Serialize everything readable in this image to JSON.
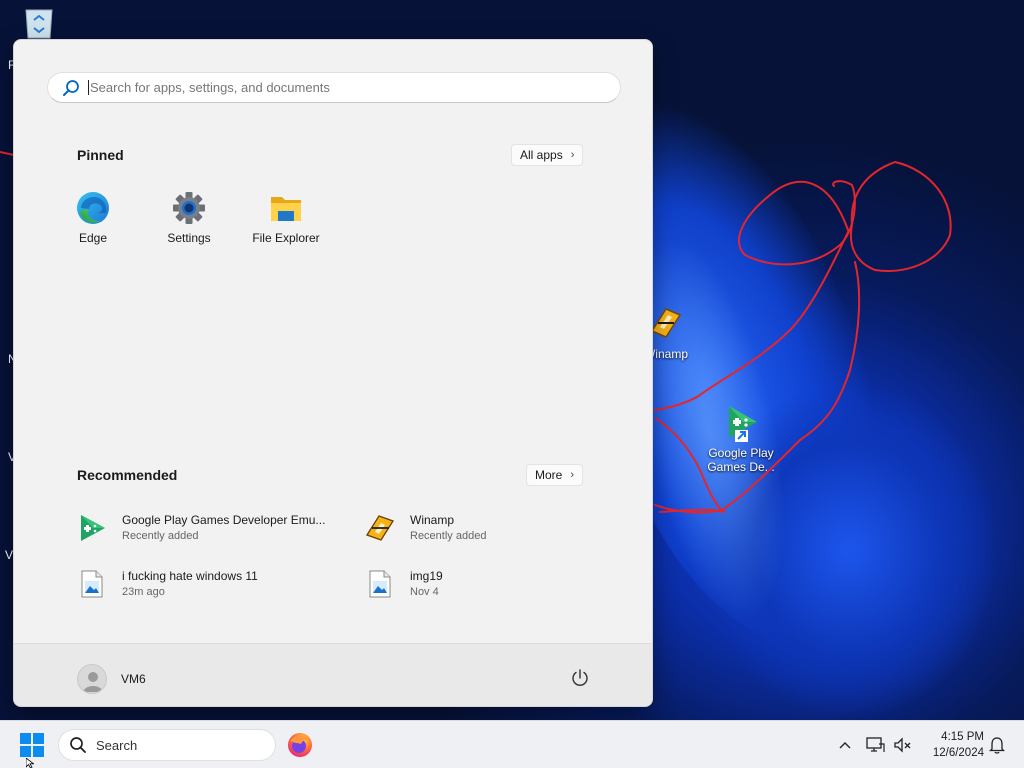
{
  "desktop": {
    "icons": [
      {
        "label": "Winamp",
        "icon": "winamp-icon"
      },
      {
        "label": "Google Play Games De...",
        "icon": "google-play-games-icon"
      }
    ],
    "edge_labels": [
      "R",
      "N",
      "V",
      "V"
    ]
  },
  "start_menu": {
    "search_placeholder": "Search for apps, settings, and documents",
    "pinned_title": "Pinned",
    "all_apps_label": "All apps",
    "pinned": [
      {
        "label": "Edge",
        "icon": "edge-icon"
      },
      {
        "label": "Settings",
        "icon": "settings-gear-icon"
      },
      {
        "label": "File Explorer",
        "icon": "folder-icon"
      }
    ],
    "recommended_title": "Recommended",
    "more_label": "More",
    "recommended": [
      {
        "name": "Google Play Games Developer Emu...",
        "sub": "Recently added",
        "icon": "google-play-games-icon"
      },
      {
        "name": "Winamp",
        "sub": "Recently added",
        "icon": "winamp-icon"
      },
      {
        "name": "i fucking hate windows 11",
        "sub": "23m ago",
        "icon": "image-file-icon"
      },
      {
        "name": "img19",
        "sub": "Nov 4",
        "icon": "image-file-icon"
      }
    ],
    "user_name": "VM6"
  },
  "taskbar": {
    "search_label": "Search",
    "time": "4:15 PM",
    "date": "12/6/2024"
  },
  "colors": {
    "accent": "#0067c0",
    "scribble": "#e4262c",
    "start_bg": "#f2f2f2",
    "taskbar_bg": "#eef0f4"
  }
}
